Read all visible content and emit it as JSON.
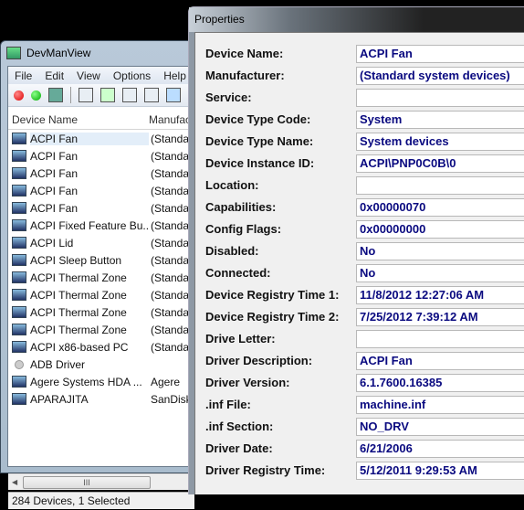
{
  "devmanview": {
    "title": "DevManView",
    "menu": [
      "File",
      "Edit",
      "View",
      "Options",
      "Help"
    ],
    "toolbar": [
      "red-dot-icon",
      "green-dot-icon",
      "network-icon",
      "save-icon",
      "refresh-icon",
      "copy-icon",
      "properties-icon",
      "find-icon"
    ],
    "columns": [
      "Device Name",
      "Manufac"
    ],
    "rows": [
      {
        "name": "ACPI Fan",
        "manufacturer": "(Standar",
        "selected": true
      },
      {
        "name": "ACPI Fan",
        "manufacturer": "(Standar"
      },
      {
        "name": "ACPI Fan",
        "manufacturer": "(Standar"
      },
      {
        "name": "ACPI Fan",
        "manufacturer": "(Standar"
      },
      {
        "name": "ACPI Fan",
        "manufacturer": "(Standar"
      },
      {
        "name": "ACPI Fixed Feature Bu...",
        "manufacturer": "(Standar"
      },
      {
        "name": "ACPI Lid",
        "manufacturer": "(Standar"
      },
      {
        "name": "ACPI Sleep Button",
        "manufacturer": "(Standar"
      },
      {
        "name": "ACPI Thermal Zone",
        "manufacturer": "(Standar"
      },
      {
        "name": "ACPI Thermal Zone",
        "manufacturer": "(Standar"
      },
      {
        "name": "ACPI Thermal Zone",
        "manufacturer": "(Standar"
      },
      {
        "name": "ACPI Thermal Zone",
        "manufacturer": "(Standar"
      },
      {
        "name": "ACPI x86-based PC",
        "manufacturer": "(Standar"
      },
      {
        "name": "ADB Driver",
        "manufacturer": ""
      },
      {
        "name": "Agere Systems HDA ...",
        "manufacturer": "Agere"
      },
      {
        "name": "APARAJITA",
        "manufacturer": "SanDisk"
      }
    ],
    "scroll_grip": "III",
    "status": "284 Devices, 1 Selected"
  },
  "properties": {
    "title": "Properties",
    "fields": [
      {
        "label": "Device Name:",
        "value": "ACPI Fan"
      },
      {
        "label": "Manufacturer:",
        "value": "(Standard system devices)"
      },
      {
        "label": "Service:",
        "value": ""
      },
      {
        "label": "Device Type Code:",
        "value": "System"
      },
      {
        "label": "Device Type Name:",
        "value": "System devices"
      },
      {
        "label": "Device Instance ID:",
        "value": "ACPI\\PNP0C0B\\0"
      },
      {
        "label": "Location:",
        "value": ""
      },
      {
        "label": "Capabilities:",
        "value": "0x00000070"
      },
      {
        "label": "Config Flags:",
        "value": "0x00000000"
      },
      {
        "label": "Disabled:",
        "value": "No"
      },
      {
        "label": "Connected:",
        "value": "No"
      },
      {
        "label": "Device Registry Time 1:",
        "value": "11/8/2012 12:27:06 AM"
      },
      {
        "label": "Device Registry Time 2:",
        "value": "7/25/2012 7:39:12 AM"
      },
      {
        "label": "Drive Letter:",
        "value": ""
      },
      {
        "label": "Driver Description:",
        "value": "ACPI Fan"
      },
      {
        "label": "Driver Version:",
        "value": "6.1.7600.16385"
      },
      {
        "label": ".inf File:",
        "value": "machine.inf"
      },
      {
        "label": ".inf Section:",
        "value": "NO_DRV"
      },
      {
        "label": "Driver Date:",
        "value": "6/21/2006"
      },
      {
        "label": "Driver Registry Time:",
        "value": "5/12/2011 9:29:53 AM"
      }
    ]
  }
}
